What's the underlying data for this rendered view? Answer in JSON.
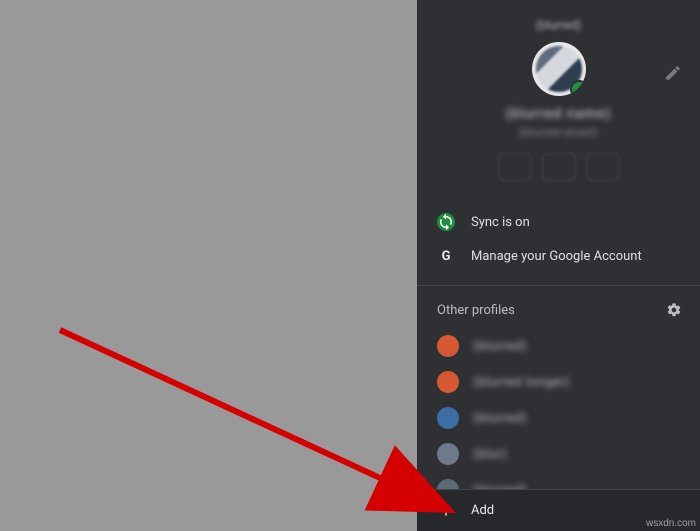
{
  "panel": {
    "title": "(blurred)",
    "user_name": "(blurred name)",
    "user_email": "(blurred email)"
  },
  "menu": {
    "sync": "Sync is on",
    "manage": "Manage your Google Account"
  },
  "profiles_header": "Other profiles",
  "profiles": [
    {
      "label": "(blurred)",
      "color": "#d65a31"
    },
    {
      "label": "(blurred longer)",
      "color": "#d65a31"
    },
    {
      "label": "(blurred)",
      "color": "#3a6ea5"
    },
    {
      "label": "(blur)",
      "color": "#6c7a89"
    },
    {
      "label": "(blurred)",
      "color": "#5b6b73"
    }
  ],
  "add_label": "Add",
  "watermark": "wsxdn.com"
}
